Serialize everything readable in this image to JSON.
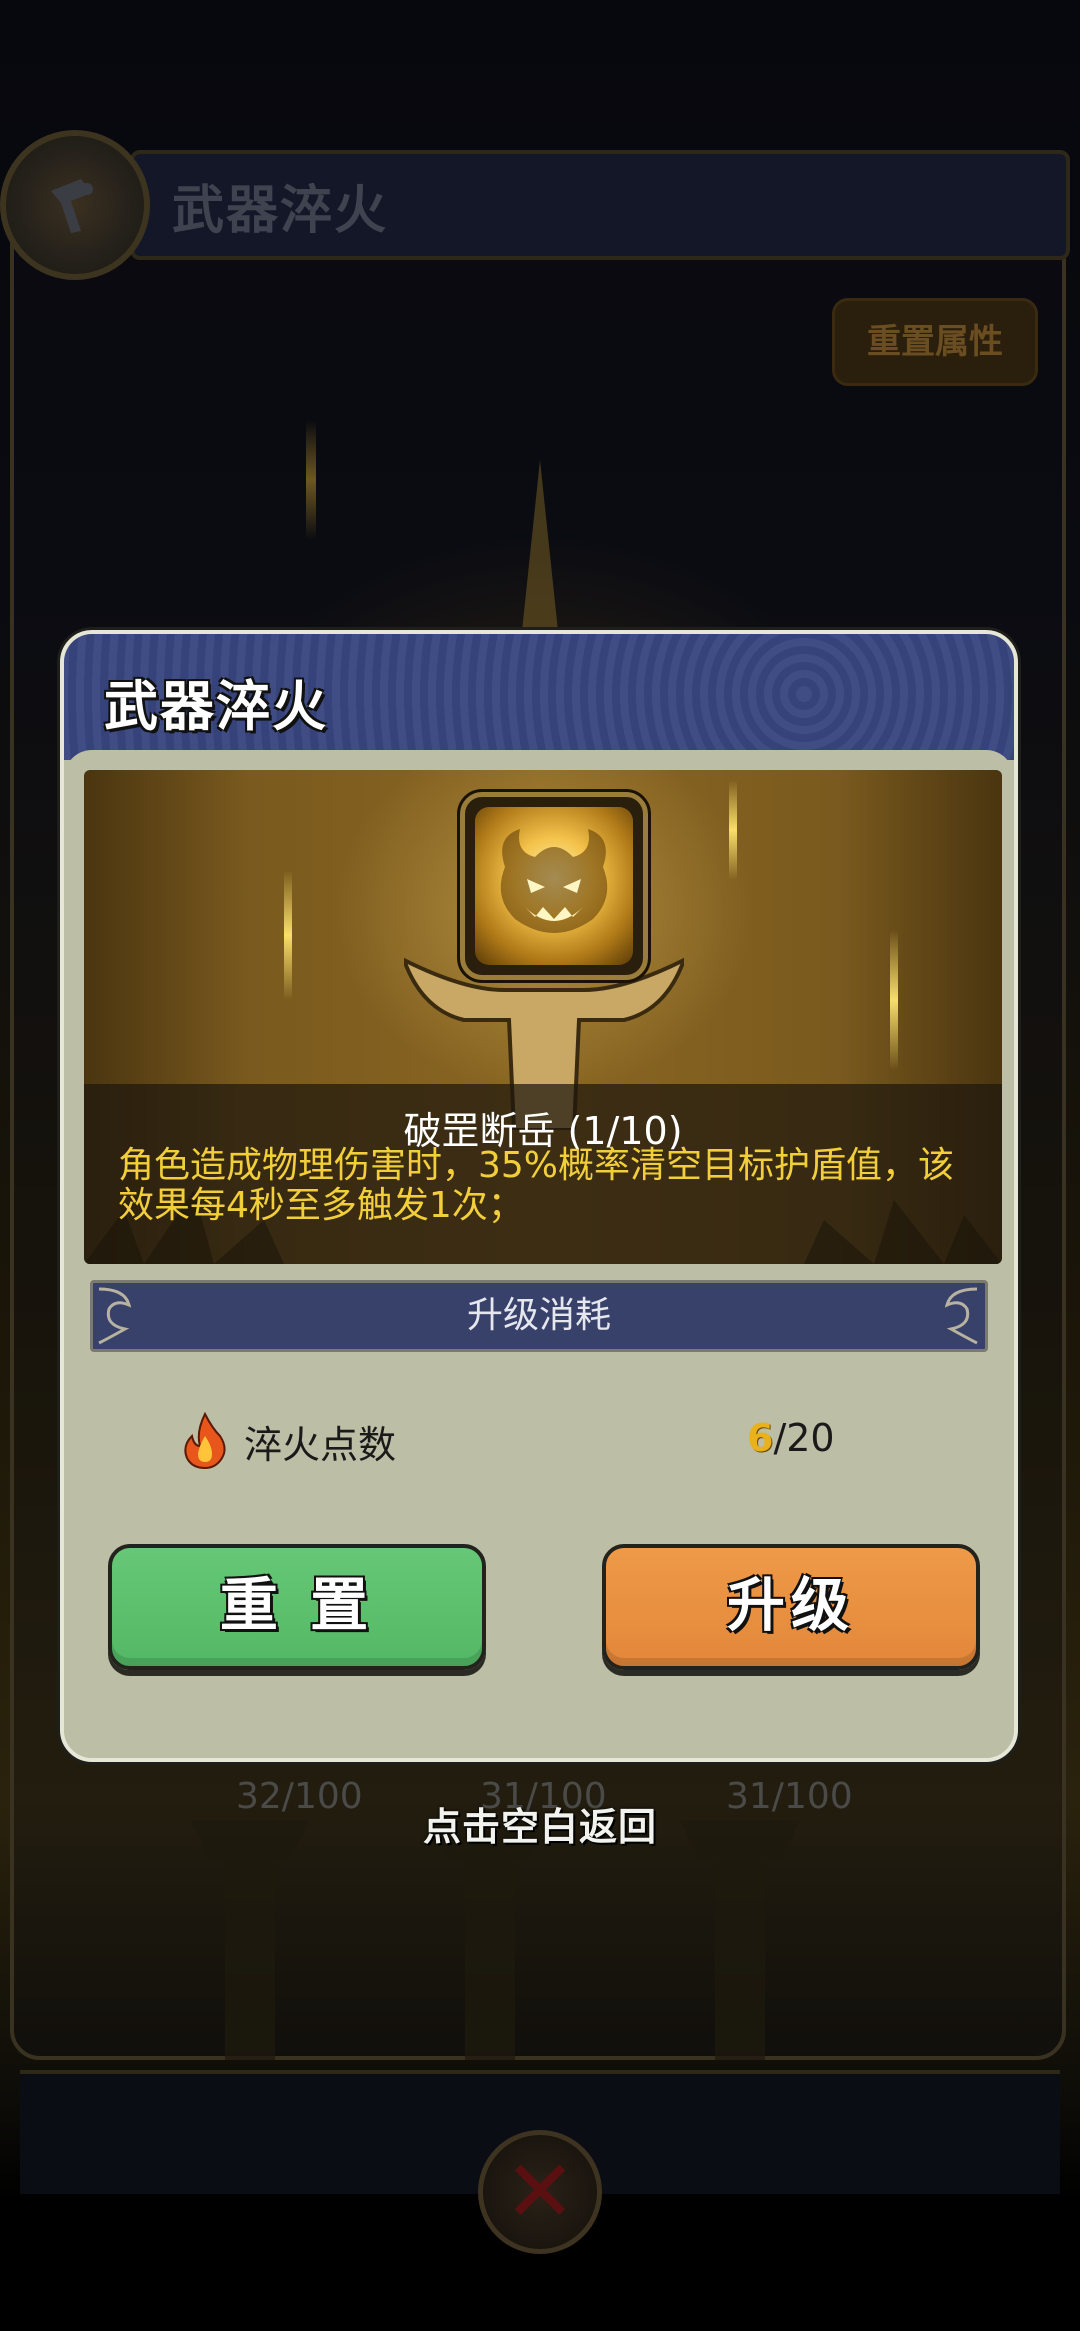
{
  "background": {
    "header_title": "武器淬火",
    "reset_attributes_button": "重置属性",
    "slot_values": [
      "32/100",
      "31/100",
      "31/100"
    ],
    "hint": "点击空白返回",
    "close_icon": "close-x-icon"
  },
  "dialog": {
    "title": "武器淬火",
    "skill": {
      "name": "破罡断岳 (1/10)",
      "description": "角色造成物理伤害时，35%概率清空目标护盾值，该效果每4秒至多触发1次；",
      "icon": "demon-face-skill-icon"
    },
    "cost": {
      "section_label": "升级消耗",
      "items": [
        {
          "icon": "flame-icon",
          "name": "淬火点数",
          "current": "6",
          "required": "/20"
        }
      ]
    },
    "buttons": {
      "reset": "重 置",
      "upgrade": "升级"
    }
  },
  "colors": {
    "dialog_header": "#38457f",
    "dialog_body": "#bcbea5",
    "reset_button": "#5cbf6d",
    "upgrade_button": "#e8903f",
    "desc_text": "#f2cf3a",
    "cost_current": "#e9b21a"
  }
}
